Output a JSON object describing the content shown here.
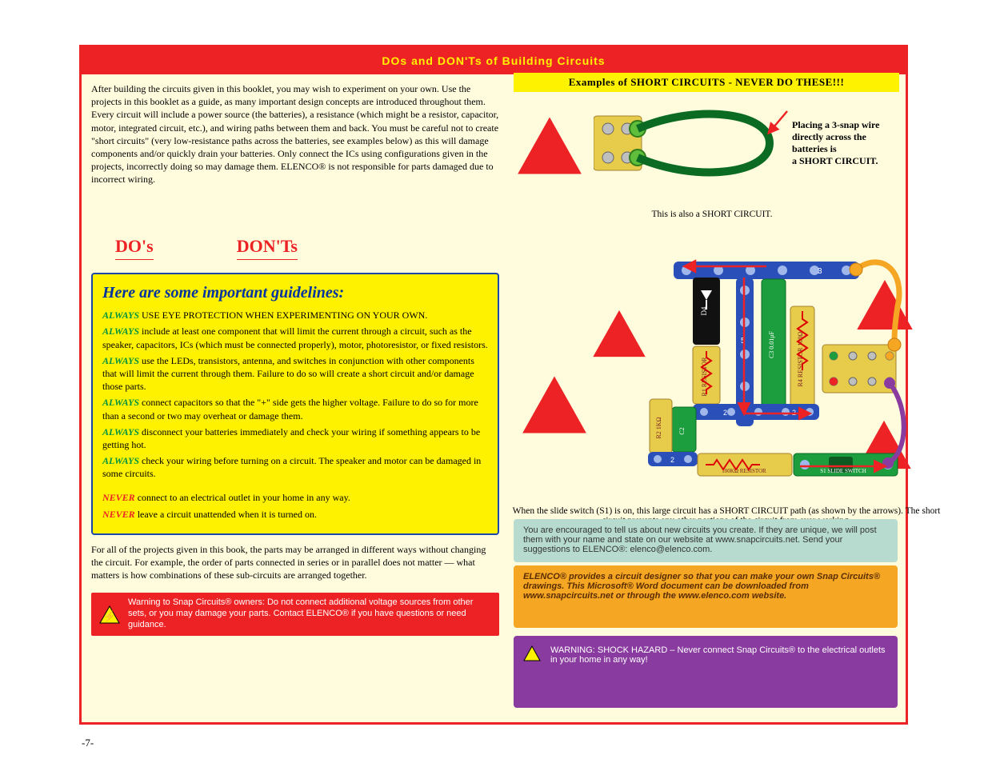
{
  "meta": {
    "page_number": "-7-"
  },
  "title": "DOs and DON'Ts of Building Circuits",
  "left": {
    "intro": "After building the circuits given in this booklet, you may wish to experiment on your own. Use the projects in this booklet as a guide, as many important design concepts are introduced throughout them. Every circuit will include a power source (the batteries), a resistance (which might be a resistor, capacitor, motor, integrated circuit, etc.), and wiring paths between them and back. You must be careful not to create \"short circuits\" (very low-resistance paths across the batteries, see examples below) as this will damage components and/or quickly drain your batteries. Only connect the ICs using configurations given in the projects, incorrectly doing so may damage them. ELENCO® is not responsible for parts damaged due to incorrect wiring.",
    "h2a": "DO's",
    "h2b": "DON'Ts",
    "guidelines_title": "Here are some important guidelines:",
    "guidelines_always": [
      "USE EYE PROTECTION WHEN EXPERIMENTING ON YOUR OWN.",
      "include at least one component that will limit the current through a circuit, such as the speaker, capacitors, ICs (which must be connected properly), motor, photoresistor, or fixed resistors.",
      "use the LEDs, transistors, antenna, and switches in conjunction with other components that will limit the current through them. Failure to do so will create a short circuit and/or damage those parts.",
      "connect capacitors so that the \"+\" side gets the higher voltage. Failure to do so for more than a second or two may overheat or damage them.",
      "disconnect your batteries immediately and check your wiring if something appears to be getting hot.",
      "check your wiring before turning on a circuit. The speaker and motor can be damaged in some circuits."
    ],
    "guidelines_never": [
      "connect to an electrical outlet in your home in any way.",
      "leave a circuit unattended when it is turned on."
    ],
    "design_para": "For all of the projects given in this book, the parts may be arranged in different ways without changing the circuit. For example, the order of parts connected in series or in parallel does not matter — what matters is how combinations of these sub-circuits are arranged together.",
    "red_bar": "Warning to Snap Circuits® owners: Do not connect additional voltage sources from other sets, or you may damage your parts. Contact ELENCO® if you have questions or need guidance."
  },
  "right": {
    "sig_header": "Examples of SHORT CIRCUITS - NEVER DO THESE!!!",
    "short_caption_a": "Placing a 3-snap wire",
    "short_caption_b": "directly across the batteries is",
    "short_caption_c": "a SHORT CIRCUIT.",
    "big_label_a": "This is also a",
    "big_label_b": "SHORT CIRCUIT.",
    "example_caption": "When the slide switch (S1) is on, this large circuit has a SHORT CIRCUIT path (as shown by the arrows). The short circuit prevents any other portions of the circuit from ever working.",
    "sig_teal": "You are encouraged to tell us about new circuits you create. If they are unique, we will post them with your name and state on our website at www.snapcircuits.net. Send your suggestions to ELENCO®: elenco@elenco.com.",
    "sig_orange": "ELENCO® provides a circuit designer so that you can make your own Snap Circuits® drawings. This Microsoft® Word document can be downloaded from www.snapcircuits.net or through the www.elenco.com website.",
    "sig_purple": "WARNING: SHOCK HAZARD – Never connect Snap Circuits® to the electrical outlets in your home in any way!"
  }
}
